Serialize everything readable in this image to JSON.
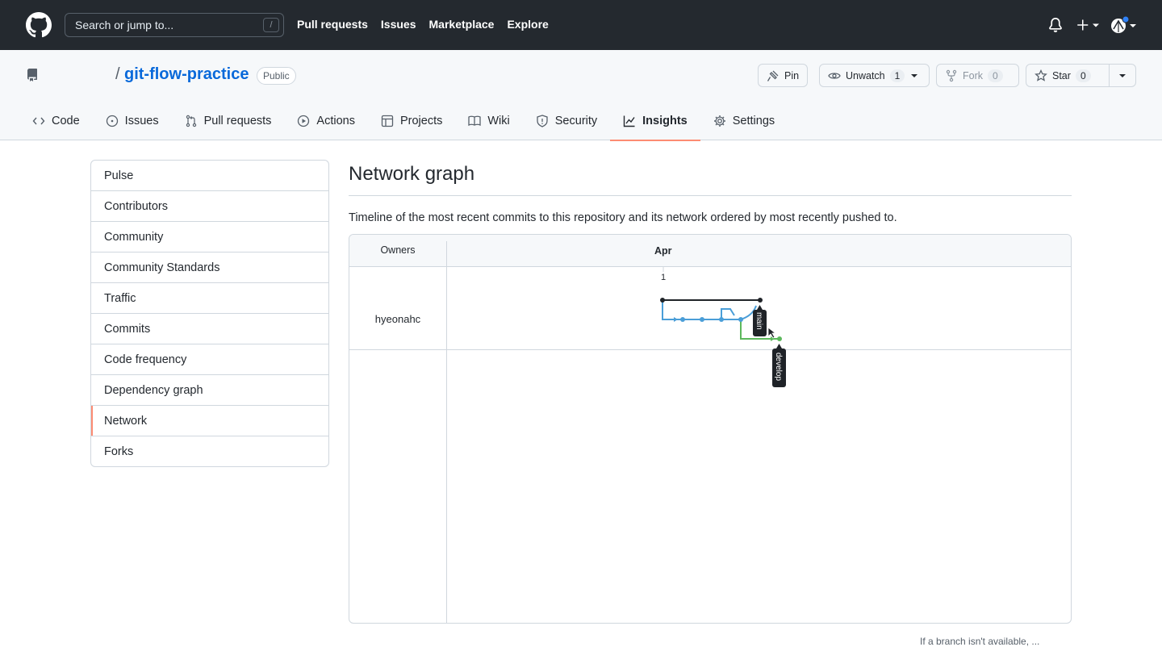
{
  "header": {
    "search_placeholder": "Search or jump to...",
    "search_shortcut": "/",
    "nav": [
      "Pull requests",
      "Issues",
      "Marketplace",
      "Explore"
    ]
  },
  "repo": {
    "slash": "/",
    "name": "git-flow-practice",
    "visibility": "Public",
    "buttons": {
      "pin": "Pin",
      "unwatch": "Unwatch",
      "unwatch_count": "1",
      "fork": "Fork",
      "fork_count": "0",
      "star": "Star",
      "star_count": "0"
    },
    "tabs": [
      {
        "label": "Code",
        "icon": "code-icon"
      },
      {
        "label": "Issues",
        "icon": "issue-icon"
      },
      {
        "label": "Pull requests",
        "icon": "pull-request-icon"
      },
      {
        "label": "Actions",
        "icon": "play-icon"
      },
      {
        "label": "Projects",
        "icon": "table-icon"
      },
      {
        "label": "Wiki",
        "icon": "book-icon"
      },
      {
        "label": "Security",
        "icon": "shield-icon"
      },
      {
        "label": "Insights",
        "icon": "graph-icon"
      },
      {
        "label": "Settings",
        "icon": "gear-icon"
      }
    ],
    "selected_tab": "Insights"
  },
  "sidebar": {
    "items": [
      "Pulse",
      "Contributors",
      "Community",
      "Community Standards",
      "Traffic",
      "Commits",
      "Code frequency",
      "Dependency graph",
      "Network",
      "Forks"
    ],
    "active": "Network"
  },
  "main": {
    "title": "Network graph",
    "description": "Timeline of the most recent commits to this repository and its network ordered by most recently pushed to.",
    "graph": {
      "owners_header": "Owners",
      "month": "Apr",
      "day": "1",
      "owner": "hyeonahc",
      "branches": [
        "main",
        "develop"
      ]
    },
    "footer_note": "If a branch isn't available, ..."
  },
  "colors": {
    "header_bg": "#24292f",
    "accent": "#fd8c73",
    "link": "#0969da",
    "branch_main": "#1f2328",
    "branch_blue": "#4a9ed8",
    "branch_green": "#5cb85c"
  }
}
